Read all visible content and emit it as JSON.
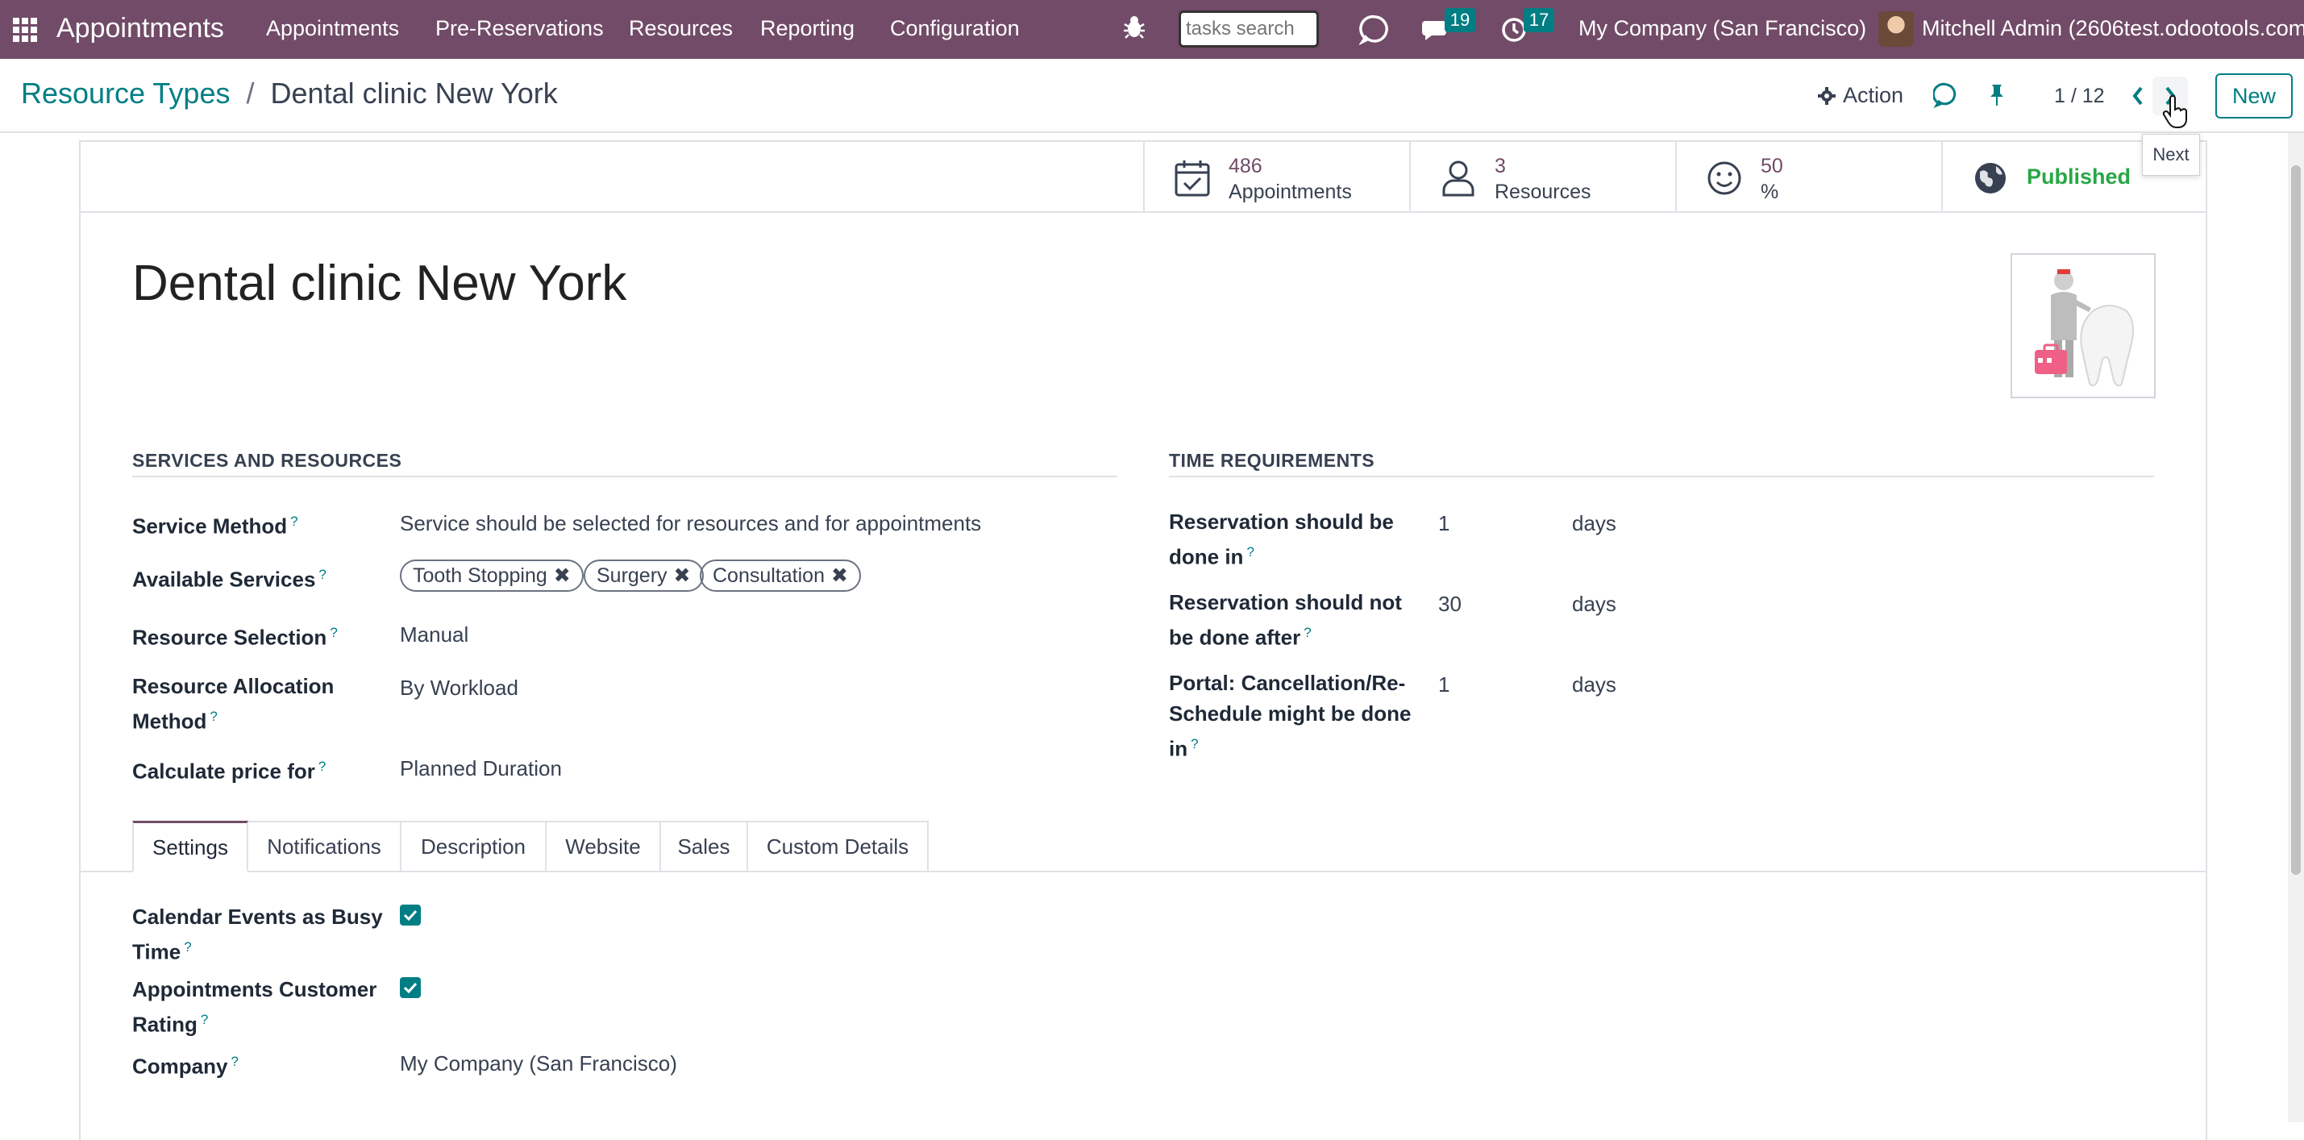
{
  "navbar": {
    "app_name": "Appointments",
    "menu": [
      "Appointments",
      "Pre-Reservations",
      "Resources",
      "Reporting",
      "Configuration"
    ],
    "search_placeholder": "tasks search",
    "messages_count": "19",
    "activities_count": "17",
    "company": "My Company (San Francisco)",
    "user": "Mitchell Admin (2606test.odootools.com)",
    "brand_color": "#714B67",
    "accent_color": "#017E84"
  },
  "control": {
    "breadcrumb_parent": "Resource Types",
    "breadcrumb_separator": "/",
    "breadcrumb_current": "Dental clinic New York",
    "action_label": "Action",
    "pager": "1 / 12",
    "new_label": "New",
    "tooltip": "Next"
  },
  "stats": {
    "appointments_value": "486",
    "appointments_label": "Appointments",
    "resources_value": "3",
    "resources_label": "Resources",
    "rating_value": "50",
    "rating_label": "%",
    "published_label": "Published"
  },
  "record": {
    "title": "Dental clinic New York"
  },
  "services": {
    "section_title": "SERVICES AND RESOURCES",
    "service_method_label": "Service Method",
    "service_method_value": "Service should be selected for resources and for appointments",
    "available_services_label": "Available Services",
    "tags": [
      "Tooth Stopping",
      "Surgery",
      "Consultation"
    ],
    "resource_selection_label": "Resource Selection",
    "resource_selection_value": "Manual",
    "allocation_label_1": "Resource Allocation",
    "allocation_label_2": "Method",
    "allocation_value": "By Workload",
    "price_label": "Calculate price for",
    "price_value": "Planned Duration"
  },
  "time": {
    "section_title": "TIME REQUIREMENTS",
    "r1_label_1": "Reservation should be",
    "r1_label_2": "done in",
    "r1_value": "1",
    "r1_unit": "days",
    "r2_label_1": "Reservation should not",
    "r2_label_2": "be done after",
    "r2_value": "30",
    "r2_unit": "days",
    "r3_label_1": "Portal: Cancellation/Re-",
    "r3_label_2": "Schedule might be done",
    "r3_label_3": "in",
    "r3_value": "1",
    "r3_unit": "days"
  },
  "tabs": [
    "Settings",
    "Notifications",
    "Description",
    "Website",
    "Sales",
    "Custom Details"
  ],
  "settings": {
    "busy_label_1": "Calendar Events as Busy",
    "busy_label_2": "Time",
    "busy_checked": true,
    "rating_label_1": "Appointments Customer",
    "rating_label_2": "Rating",
    "rating_checked": true,
    "company_label": "Company",
    "company_value": "My Company (San Francisco)"
  },
  "help_marker": "?"
}
